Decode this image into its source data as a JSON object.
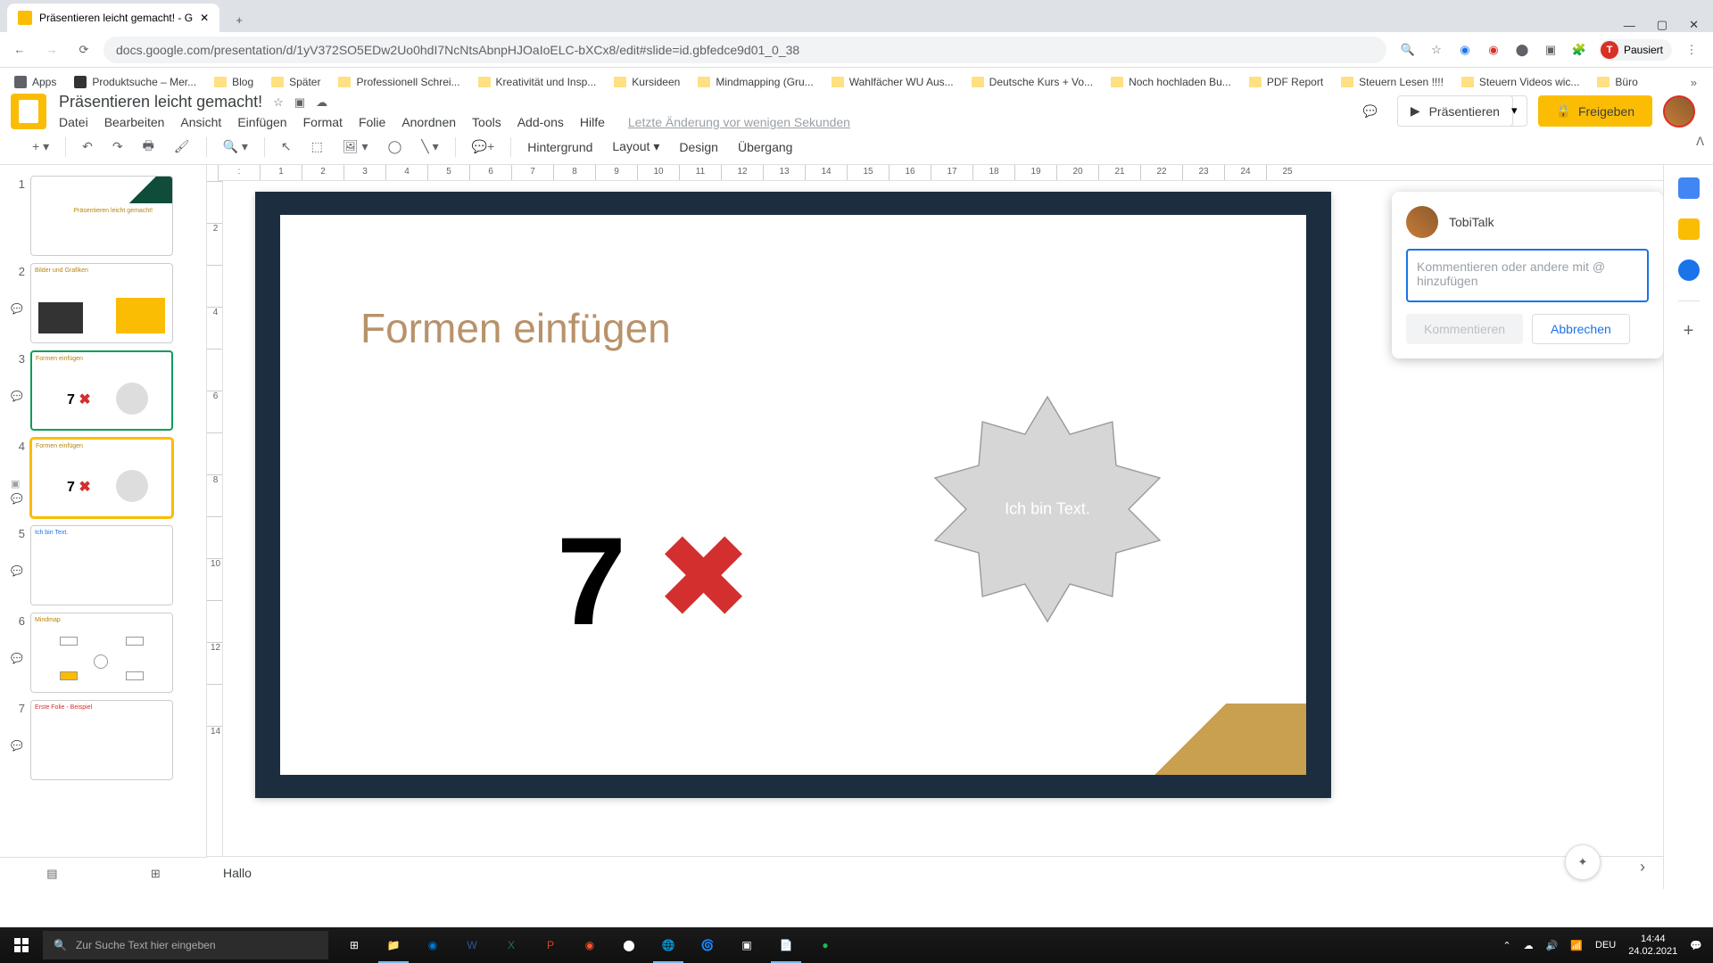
{
  "browser": {
    "tab_title": "Präsentieren leicht gemacht! - G",
    "url": "docs.google.com/presentation/d/1yV372SO5EDw2Uo0hdI7NcNtsAbnpHJOaIoELC-bXCx8/edit#slide=id.gbfedce9d01_0_38",
    "profile_status": "Pausiert",
    "bookmarks": [
      "Apps",
      "Produktsuche – Mer...",
      "Blog",
      "Später",
      "Professionell Schrei...",
      "Kreativität und Insp...",
      "Kursideen",
      "Mindmapping (Gru...",
      "Wahlfächer WU Aus...",
      "Deutsche Kurs + Vo...",
      "Noch hochladen Bu...",
      "PDF Report",
      "Steuern Lesen !!!!",
      "Steuern Videos wic...",
      "Büro"
    ]
  },
  "app": {
    "doc_title": "Präsentieren leicht gemacht!",
    "menus": [
      "Datei",
      "Bearbeiten",
      "Ansicht",
      "Einfügen",
      "Format",
      "Folie",
      "Anordnen",
      "Tools",
      "Add-ons",
      "Hilfe"
    ],
    "last_edit": "Letzte Änderung vor wenigen Sekunden",
    "present": "Präsentieren",
    "share": "Freigeben"
  },
  "toolbar": {
    "background": "Hintergrund",
    "layout": "Layout",
    "design": "Design",
    "transition": "Übergang"
  },
  "slide": {
    "title": "Formen einfügen",
    "seven": "7",
    "shape_text": "Ich bin Text."
  },
  "ruler_h": [
    ":",
    1,
    2,
    3,
    4,
    5,
    6,
    7,
    8,
    9,
    10,
    11,
    12,
    13,
    14,
    15,
    16,
    17,
    18,
    19,
    20,
    21,
    22,
    23,
    24,
    25
  ],
  "ruler_v": [
    2,
    4,
    6,
    8,
    10,
    12,
    14
  ],
  "comment": {
    "user": "TobiTalk",
    "placeholder": "Kommentieren oder andere mit @ hinzufügen",
    "submit": "Kommentieren",
    "cancel": "Abbrechen"
  },
  "notes": "Hallo",
  "taskbar": {
    "search_placeholder": "Zur Suche Text hier eingeben",
    "lang": "DEU",
    "time": "14:44",
    "date": "24.02.2021"
  },
  "slides": {
    "1": 1,
    "2": 2,
    "3": 3,
    "4": 4,
    "5": 5,
    "6": 6,
    "7": 7
  }
}
